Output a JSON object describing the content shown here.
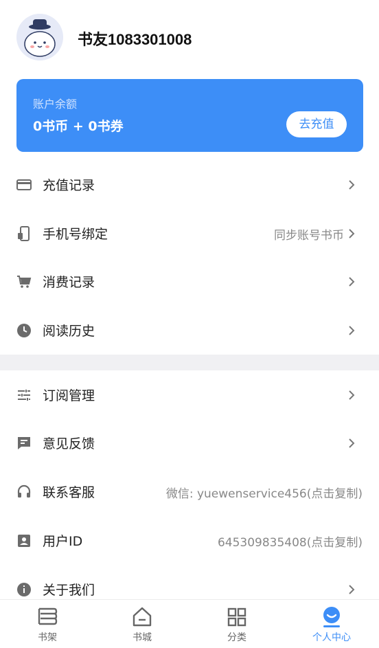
{
  "profile": {
    "username": "书友1083301008"
  },
  "balance": {
    "label": "账户余额",
    "value": "0书币 + 0书券",
    "recharge_label": "去充值"
  },
  "menu_group_1": [
    {
      "label": "充值记录",
      "right": "",
      "icon": "credit-card-icon"
    },
    {
      "label": "手机号绑定",
      "right": "同步账号书币",
      "icon": "phone-icon"
    },
    {
      "label": "消费记录",
      "right": "",
      "icon": "cart-icon"
    },
    {
      "label": "阅读历史",
      "right": "",
      "icon": "clock-icon"
    }
  ],
  "menu_group_2": [
    {
      "label": "订阅管理",
      "right": "",
      "icon": "sliders-icon"
    },
    {
      "label": "意见反馈",
      "right": "",
      "icon": "feedback-icon"
    },
    {
      "label": "联系客服",
      "right": "微信: yuewenservice456(点击复制)",
      "icon": "headset-icon"
    },
    {
      "label": "用户ID",
      "right": "645309835408(点击复制)",
      "icon": "id-card-icon"
    },
    {
      "label": "关于我们",
      "right": "",
      "icon": "info-icon"
    }
  ],
  "tabbar": {
    "tabs": [
      {
        "label": "书架",
        "icon": "bookshelf-icon",
        "active": false
      },
      {
        "label": "书城",
        "icon": "bookstore-icon",
        "active": false
      },
      {
        "label": "分类",
        "icon": "grid-icon",
        "active": false
      },
      {
        "label": "个人中心",
        "icon": "smile-icon",
        "active": true
      }
    ]
  },
  "colors": {
    "accent": "#3d8ef7",
    "icon_gray": "#6b6b6b",
    "divider": "#f0f0f3"
  }
}
